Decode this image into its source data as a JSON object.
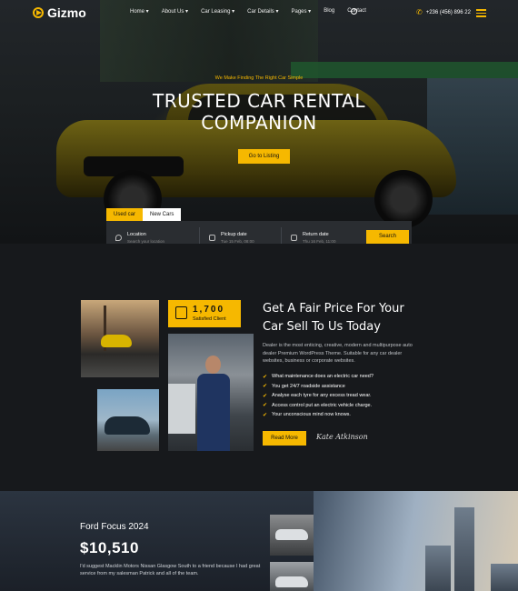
{
  "brand": {
    "name": "Gizmo",
    "accent": "#f6b800"
  },
  "nav": {
    "items": [
      "Home",
      "About Us",
      "Car Leasing",
      "Car Details",
      "Pages",
      "Blog",
      "Contact"
    ],
    "phone": "+236 (456) 896 22"
  },
  "hero": {
    "tagline": "We Make Finding The Right Car Simple",
    "title_line1": "TRUSTED CAR RENTAL",
    "title_line2": "COMPANION",
    "cta": "Go to Listing"
  },
  "search": {
    "tabs": [
      "Used car",
      "New Cars"
    ],
    "active_tab": "Used car",
    "fields": [
      {
        "label": "Location",
        "placeholder": "Search your location",
        "icon": "map-pin-icon"
      },
      {
        "label": "Pickup date",
        "placeholder": "Tue 15 Feb, 08:00",
        "icon": "calendar-icon"
      },
      {
        "label": "Return date",
        "placeholder": "Thu 16 Feb, 11:00",
        "icon": "calendar-icon"
      }
    ],
    "button": "Search"
  },
  "about": {
    "stat_value": "1,700",
    "stat_label": "Satisfied Client",
    "heading_line1": "Get A Fair Price For Your",
    "heading_line2": "Car Sell To Us Today",
    "description": "Dealer is the most enticing, creative, modern and multipurpose auto dealer Premium WordPress Theme. Suitable for any car dealer websites, business or corporate websites.",
    "checklist": [
      "What maintenance does an electric car need?",
      "You get 24/7 roadside assistance",
      "Analyse each tyre for any excess tread wear.",
      "Access control put an electric vehicle charge.",
      "Your unconscious mind now knows."
    ],
    "button": "Read More",
    "signature": "Kate Atkinson"
  },
  "featured": {
    "title": "Ford Focus 2024",
    "price": "$10,510",
    "description": "I'd suggest Macklin Motors Nissan Glasgow South to a friend because I had great service from my salesman Patrick and all of the team."
  }
}
